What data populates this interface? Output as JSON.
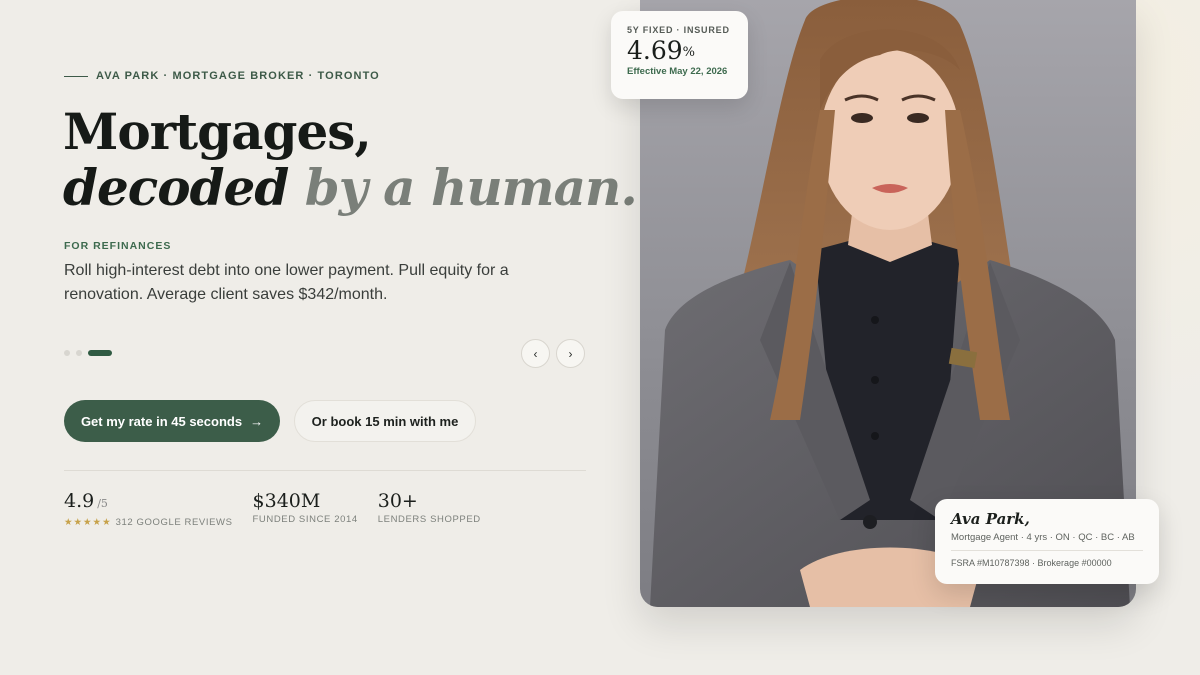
{
  "eyebrow": "AVA PARK · MORTGAGE BROKER · TORONTO",
  "headline": {
    "line1": "Mortgages,",
    "line2_italic": "decoded",
    "line2_muted": "by a human."
  },
  "slide": {
    "kicker": "FOR REFINANCES",
    "description": "Roll high-interest debt into one lower payment. Pull equity for a renovation. Average client saves $342/month.",
    "total_slides": 3,
    "active_slide": 3
  },
  "nav": {
    "prev_icon": "chevron-left-icon",
    "next_icon": "chevron-right-icon",
    "prev": "‹",
    "next": "›"
  },
  "cta": {
    "primary_label": "Get my rate in 45 seconds",
    "primary_arrow": "→",
    "secondary_label": "Or book 15 min with me"
  },
  "stats": [
    {
      "value": "4.9",
      "suffix": "/5",
      "stars": "★★★★★",
      "label": "312 GOOGLE REVIEWS"
    },
    {
      "value": "$340M",
      "label": "FUNDED SINCE 2014"
    },
    {
      "value": "30+",
      "label": "LENDERS SHOPPED"
    }
  ],
  "rate_card": {
    "tag": "5Y FIXED · INSURED",
    "rate": "4.69",
    "unit": "%",
    "effective": "Effective May 22, 2026"
  },
  "name_card": {
    "name": "Ava Park,",
    "role": "Mortgage Agent · 4 yrs · ON · QC · BC · AB",
    "license": "FSRA #M10787398 · Brokerage #00000"
  },
  "colors": {
    "background": "#efede8",
    "accent": "#3c5d49",
    "text": "#1b1f1c",
    "star": "#c7a24a"
  }
}
